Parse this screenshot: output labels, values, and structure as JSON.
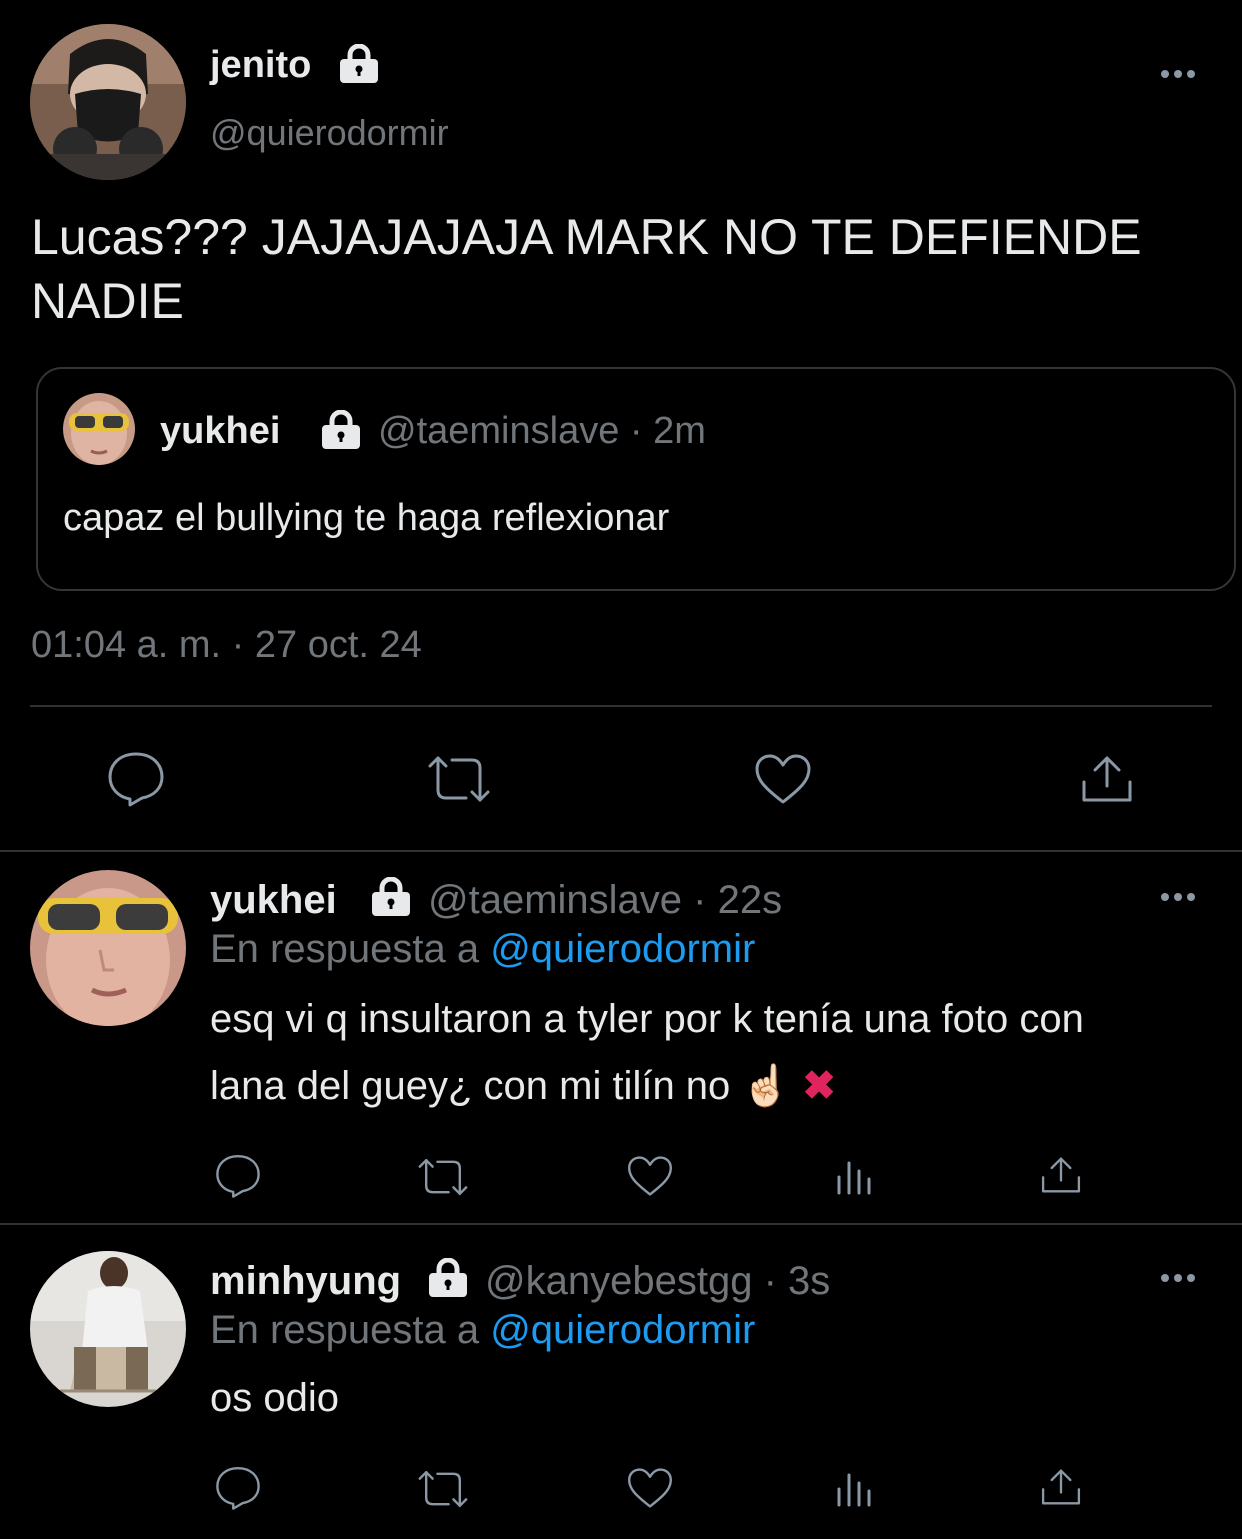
{
  "main_tweet": {
    "name": "jenito",
    "handle": "@quierodormir",
    "text_line1": "Lucas??? JAJAJAJAJA MARK NO TE DEFIENDE",
    "text_line2": "NADIE",
    "timestamp": "01:04 a. m. · 27 oct. 24",
    "quoted": {
      "name": "yukhei",
      "handle": "@taeminslave",
      "sep": "·",
      "time": "2m",
      "text": "capaz el bullying te haga reflexionar"
    }
  },
  "replies": [
    {
      "name": "yukhei",
      "handle": "@taeminslave",
      "sep": "·",
      "time": "22s",
      "reply_prefix": "En respuesta a",
      "reply_to": "@quierodormir",
      "text_line1": "esq vi q insultaron a tyler por k tenía una foto con",
      "text_line2": "lana del guey¿ con mi tilín no",
      "emoji1": "☝🏻",
      "emoji2": "✖"
    },
    {
      "name": "minhyung",
      "handle": "@kanyebestgg",
      "sep": "·",
      "time": "3s",
      "reply_prefix": "En respuesta a",
      "reply_to": "@quierodormir",
      "text_line1": "os odio"
    }
  ],
  "icons": {
    "reply": "reply-icon",
    "retweet": "retweet-icon",
    "like": "heart-icon",
    "views": "views-icon",
    "share": "share-icon",
    "more": "more-icon",
    "lock": "lock-icon"
  },
  "colors": {
    "background": "#000000",
    "text": "#e7e9ea",
    "muted": "#71767b",
    "link": "#1d9bf0",
    "divider": "#2f3336",
    "x_mark": "#e0245e"
  }
}
